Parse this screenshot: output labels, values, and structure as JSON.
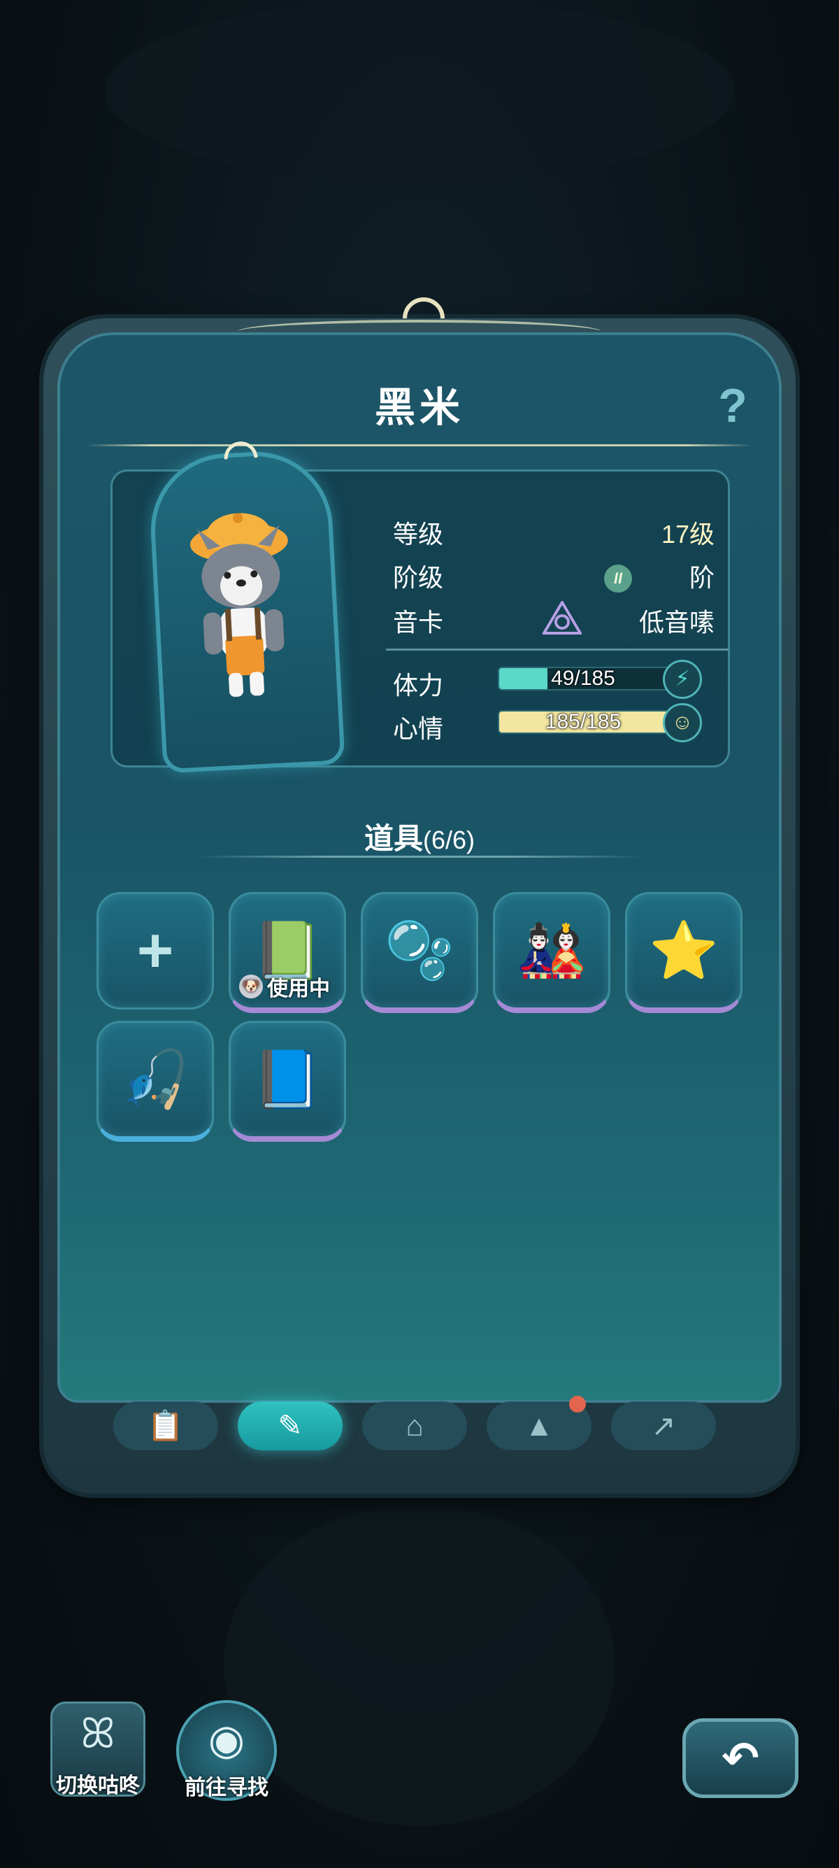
{
  "character": {
    "name": "黑米"
  },
  "stats": {
    "level_label": "等级",
    "level_value": "17级",
    "tier_label": "阶级",
    "tier_badge": "II",
    "tier_value": "阶",
    "card_label": "音卡",
    "card_value": "低音嗉",
    "stamina_label": "体力",
    "stamina_text": "49/185",
    "stamina_fraction": 0.265,
    "mood_label": "心情",
    "mood_text": "185/185",
    "mood_fraction": 1.0
  },
  "items_section": {
    "title": "道具",
    "count": "(6/6)"
  },
  "items": [
    {
      "icon": "add-icon",
      "glyph": "+",
      "rarity": "none"
    },
    {
      "icon": "green-book-icon",
      "glyph": "📗",
      "rarity": "purple",
      "status": "使用中"
    },
    {
      "icon": "bubble-icon",
      "glyph": "🫧",
      "rarity": "purple"
    },
    {
      "icon": "red-hat-doll-icon",
      "glyph": "🎎",
      "rarity": "purple"
    },
    {
      "icon": "star-balloon-icon",
      "glyph": "⭐",
      "rarity": "purple"
    },
    {
      "icon": "fishing-rod-icon",
      "glyph": "🎣",
      "rarity": "blue"
    },
    {
      "icon": "blue-book-icon",
      "glyph": "📘",
      "rarity": "purple"
    }
  ],
  "tabs": [
    {
      "icon": "clipboard-icon",
      "glyph": "📋"
    },
    {
      "icon": "tools-icon",
      "glyph": "✎",
      "active": true
    },
    {
      "icon": "hanger-icon",
      "glyph": "⌂"
    },
    {
      "icon": "cat-upgrade-icon",
      "glyph": "▲",
      "notify": true
    },
    {
      "icon": "cat-evolve-icon",
      "glyph": "↗"
    }
  ],
  "buttons": {
    "switch_label": "切换咕咚",
    "find_label": "前往寻找",
    "back_glyph": "↶"
  },
  "colors": {
    "stamina_bar": "#5ad8c8",
    "mood_bar": "#f2e6a0",
    "active_tab": "#2fc1c0",
    "notify_dot": "#e2654f"
  }
}
